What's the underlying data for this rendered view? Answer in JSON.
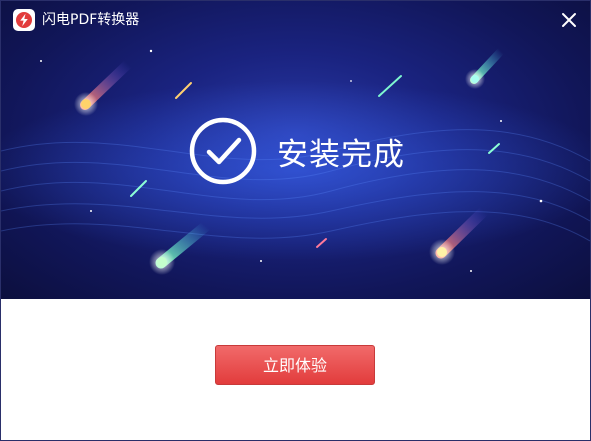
{
  "window": {
    "title": "闪电PDF转换器",
    "icons": {
      "app": "app-logo-icon",
      "close": "close-icon"
    }
  },
  "banner": {
    "status_text": "安装完成",
    "icon": "check-circle-icon",
    "colors": {
      "background": "#141a66",
      "accent": "#ffffff"
    }
  },
  "actions": {
    "primary_label": "立即体验",
    "primary_color": "#e84545"
  }
}
